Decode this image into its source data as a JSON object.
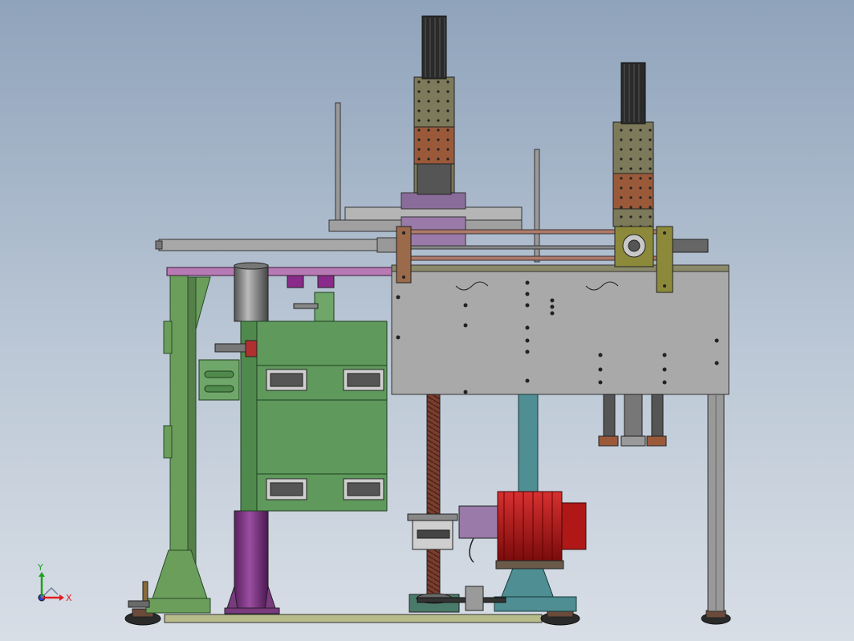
{
  "viewport": {
    "background_top": "#8fa3bb",
    "background_bottom": "#d8dee6"
  },
  "triad": {
    "x_label": "X",
    "y_label": "Y",
    "x_color": "#e02020",
    "y_color": "#20a020",
    "z_color": "#2040e0"
  },
  "colors": {
    "frame_green": "#6a9e5a",
    "panel_green": "#5f9a5c",
    "steel_gray": "#9a9a9a",
    "plate_gray": "#a9a9a9",
    "column_purple": "#7a3a7e",
    "base_olive": "#b8bc8a",
    "teal_column": "#4f8e92",
    "motor_red": "#b01818",
    "bracket_bronze": "#9a6a4a",
    "bracket_olive": "#8c8a3a",
    "screw_brown": "#7a3e2e",
    "spindle_olive": "#7c7a5a",
    "spindle_copper": "#9a5a3a",
    "spindle_dark": "#2a2a2a",
    "purple_block": "#8a2a8a"
  }
}
